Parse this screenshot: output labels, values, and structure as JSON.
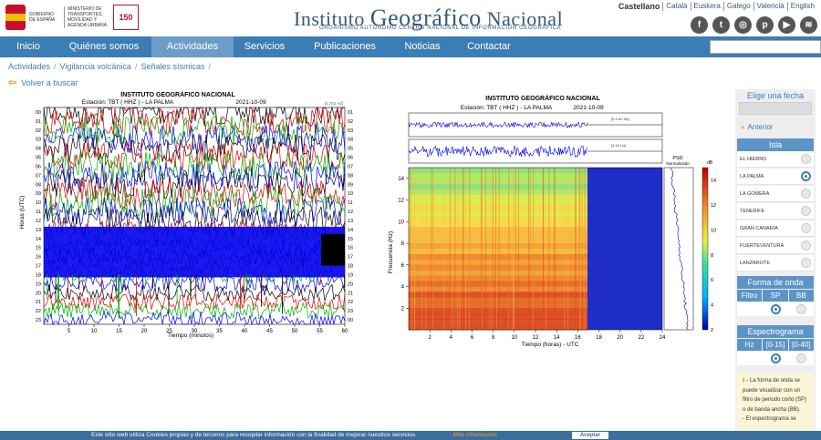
{
  "header": {
    "gov_text": "GOBIERNO DE ESPAÑA",
    "ministry_text": "MINISTERIO DE TRANSPORTES, MOVILIDAD Y AGENDA URBANA",
    "badge_text": "150",
    "title_pre": "Instituto ",
    "title_big": "Geográfico",
    "title_post": " Nacional",
    "subtitle": "Organismo Autónomo Centro Nacional de Información Geográfica",
    "languages": [
      "Castellano",
      "Català",
      "Euskera",
      "Galego",
      "Valencià",
      "English"
    ],
    "social_icons": [
      "facebook-icon",
      "twitter-icon",
      "instagram-icon",
      "pinterest-icon",
      "youtube-icon",
      "rss-icon"
    ]
  },
  "nav": {
    "items": [
      {
        "label": "Inicio",
        "width": 62
      },
      {
        "label": "Quiénes somos",
        "width": 104
      },
      {
        "label": "Actividades",
        "width": 90
      },
      {
        "label": "Servicios",
        "width": 68
      },
      {
        "label": "Publicaciones",
        "width": 108
      },
      {
        "label": "Noticias",
        "width": 62
      },
      {
        "label": "Contactar",
        "width": 84
      }
    ],
    "active": "Actividades"
  },
  "breadcrumb": [
    "Actividades",
    "Vigilancia volcánica",
    "Señales sísmicas"
  ],
  "back_label": "Volver a buscar",
  "left_chart": {
    "title": "INSTITUTO GEOGRÁFICO NACIONAL",
    "subtitle": "Estación:  TBT ( HHZ ) - LA PALMA",
    "date": "2021-10-09",
    "scale_note": "[4.752 Hz]",
    "ylabel": "Horas (UTC)",
    "xlabel": "Tiempo (minutos)",
    "xticks": [
      "5",
      "10",
      "15",
      "20",
      "25",
      "30",
      "35",
      "40",
      "45",
      "50",
      "55",
      "60"
    ],
    "hours_left": [
      "00",
      "01",
      "02",
      "03",
      "04",
      "05",
      "06",
      "07",
      "08",
      "09",
      "10",
      "11",
      "12",
      "13",
      "14",
      "15",
      "16",
      "17",
      "18",
      "19",
      "20",
      "21",
      "22",
      "23"
    ],
    "hours_right": [
      "01",
      "02",
      "03",
      "04",
      "05",
      "06",
      "07",
      "08",
      "09",
      "10",
      "11",
      "12",
      "13",
      "14",
      "15",
      "16",
      "17",
      "18",
      "19",
      "20",
      "21",
      "22",
      "23",
      "00"
    ]
  },
  "right_chart": {
    "title": "INSTITUTO GEOGRÁFICO NACIONAL",
    "subtitle": "Estación:  TBT ( HHZ ) - LA PALMA",
    "date": "2021-10-09",
    "ylabel": "Frecuencia (Hz)",
    "xlabel": "Tiempo (horas) - UTC",
    "yticks": [
      "2",
      "4",
      "6",
      "8",
      "10",
      "12",
      "14"
    ],
    "xticks": [
      "2",
      "4",
      "6",
      "8",
      "10",
      "12",
      "14",
      "16",
      "18",
      "20",
      "22",
      "24"
    ],
    "psd_label": "PSD",
    "psd_sub": "Normalizado",
    "colorbar_unit": "dB",
    "colorbar_ticks": [
      "2",
      "4",
      "6",
      "8",
      "10",
      "12",
      "14"
    ],
    "trace1_note": "[0.1-60 Hz]",
    "trace2_note": "[4-15 Hz]"
  },
  "sidebar": {
    "date_title": "Elige una fecha",
    "prev_label": "Anterior",
    "isla_title": "Isla",
    "islands": [
      {
        "name": "EL HIERRO",
        "selected": false
      },
      {
        "name": "LA PALMA",
        "selected": true
      },
      {
        "name": "LA GOMERA",
        "selected": false
      },
      {
        "name": "TENERIFE",
        "selected": false
      },
      {
        "name": "GRAN CANARIA",
        "selected": false
      },
      {
        "name": "FUERTEVENTURA",
        "selected": false
      },
      {
        "name": "LANZAROTE",
        "selected": false
      }
    ],
    "waveform_title": "Forma de onda",
    "waveform_labels": [
      "Filtro",
      "SP",
      "BB"
    ],
    "waveform_selected": "SP",
    "spectro_title": "Espectrograma",
    "spectro_labels": [
      "Hz",
      "[0-15]",
      "[0-40]"
    ],
    "spectro_selected": "[0-15]",
    "info_lines": [
      "- La forma de onda se",
      "puede visualizar con un",
      "filtro de periodo corto (SP)",
      "o de banda ancha (BB).",
      "- El espectrograma se"
    ]
  },
  "cookie": {
    "text": "Este sitio web utiliza Cookies propias y de terceros para recopilar información con la finalidad de mejorar nuestros servicios.",
    "more": "Más información",
    "accept": "Aceptar"
  }
}
